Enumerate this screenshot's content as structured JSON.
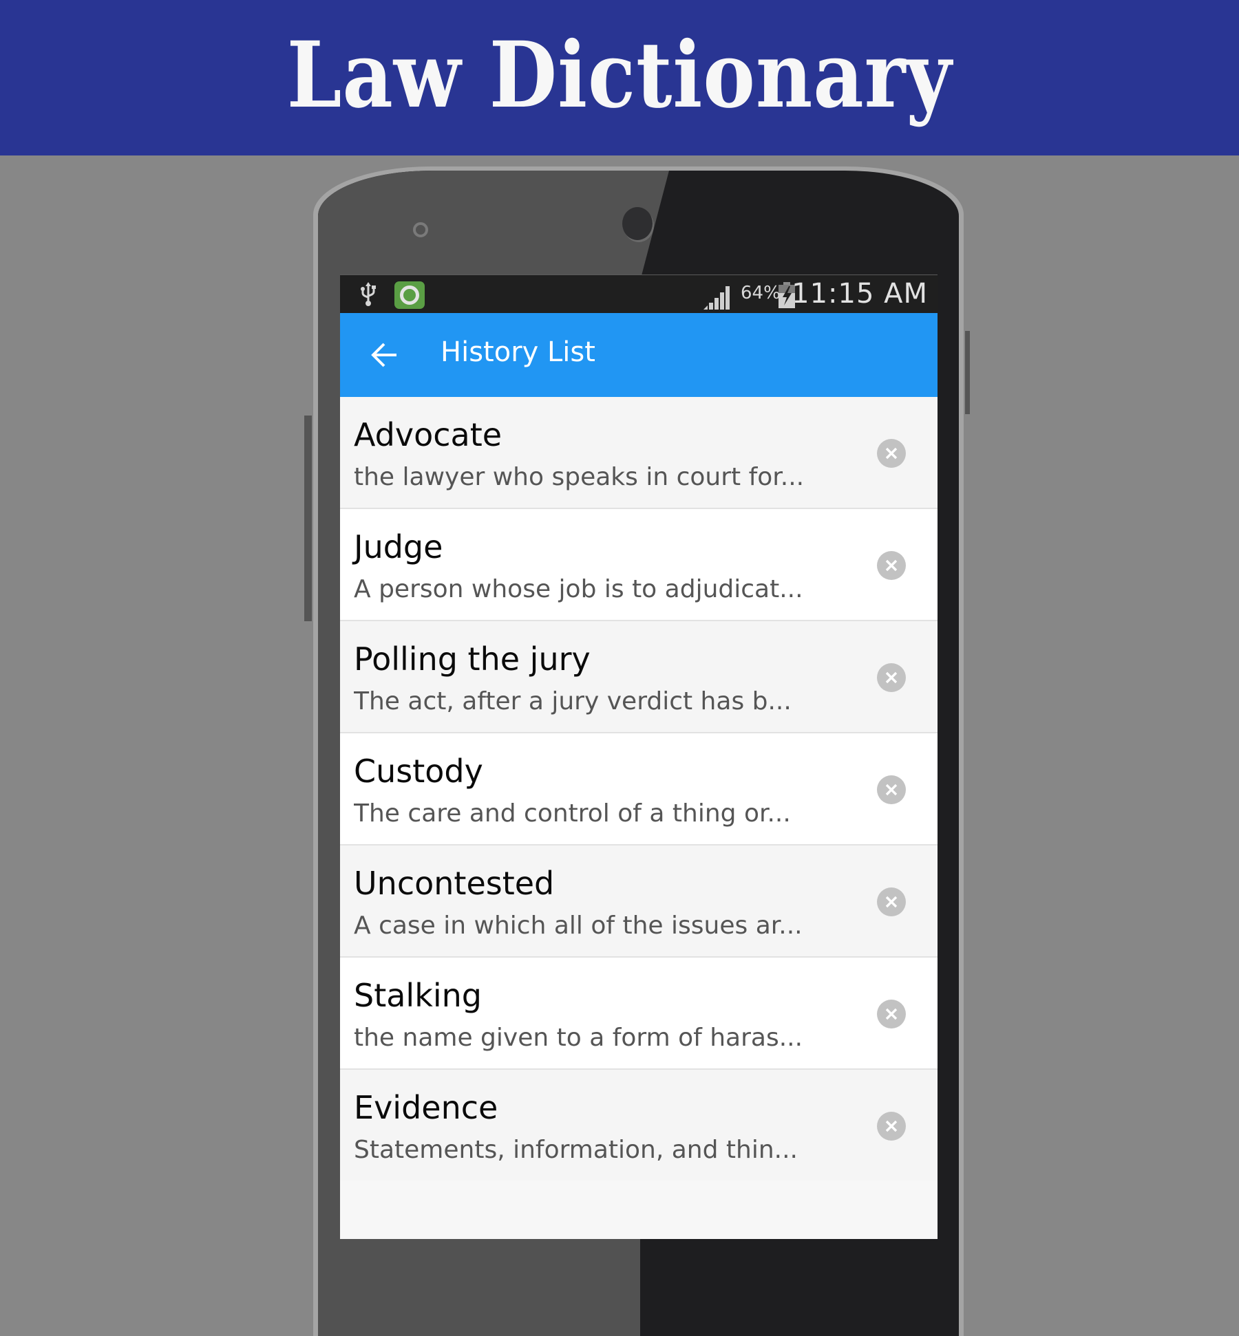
{
  "banner": {
    "title": "Law Dictionary",
    "background_color": "#293593"
  },
  "status_bar": {
    "icons": [
      "usb-icon",
      "app-notification-icon",
      "signal-icon",
      "battery-charging-icon"
    ],
    "battery_percent": "64%",
    "time": "11:15 AM"
  },
  "app_bar": {
    "back_icon": "arrow-left-icon",
    "title": "History List",
    "color": "#2196f3"
  },
  "history": {
    "items": [
      {
        "term": "Advocate",
        "definition": "the lawyer who speaks in court for..."
      },
      {
        "term": "Judge",
        "definition": "A person whose job is to adjudicat..."
      },
      {
        "term": "Polling the jury",
        "definition": "The act, after a jury verdict has b..."
      },
      {
        "term": "Custody",
        "definition": "The care and control of a thing or..."
      },
      {
        "term": "Uncontested",
        "definition": "A case in which all of the issues ar..."
      },
      {
        "term": "Stalking",
        "definition": "the name given to a form of haras..."
      },
      {
        "term": "Evidence",
        "definition": "Statements, information, and thin..."
      }
    ],
    "delete_icon": "close-circle-icon"
  }
}
